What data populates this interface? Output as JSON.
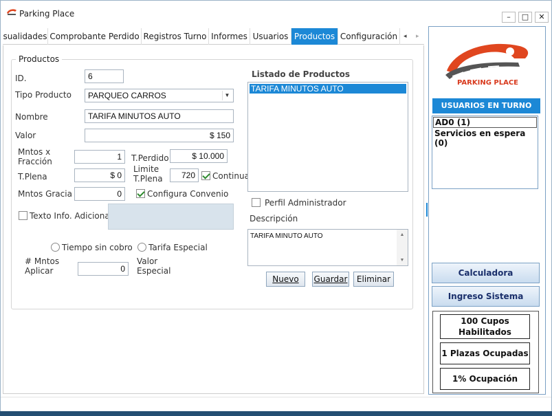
{
  "window": {
    "title": "Parking Place",
    "minimize": "–",
    "maximize": "□",
    "close": "✕"
  },
  "tabs": [
    {
      "label": "sualidades",
      "active": false
    },
    {
      "label": "Comprobante Perdido",
      "active": false
    },
    {
      "label": "Registros Turno",
      "active": false
    },
    {
      "label": "Informes",
      "active": false
    },
    {
      "label": "Usuarios",
      "active": false
    },
    {
      "label": "Productos",
      "active": true
    },
    {
      "label": "Configuración",
      "active": false
    }
  ],
  "tab_scroll": {
    "left": "◂",
    "right": "▸"
  },
  "productos": {
    "group_title": "Productos",
    "id_label": "ID.",
    "id_value": "6",
    "tipo_label": "Tipo Producto",
    "tipo_value": "PARQUEO CARROS",
    "nombre_label": "Nombre",
    "nombre_value": "TARIFA MINUTOS AUTO",
    "valor_label": "Valor",
    "valor_value": "$ 150",
    "mntos_fraccion_label_1": "Mntos x",
    "mntos_fraccion_label_2": "Fracción",
    "mntos_fraccion_value": "1",
    "tperdido_label": "T.Perdido",
    "tperdido_value": "$ 10.000",
    "tplena_label": "T.Plena",
    "tplena_value": "$ 0",
    "limite_label_1": "Limite",
    "limite_label_2": "T.Plena",
    "limite_value": "720",
    "continua_label": "Continua",
    "continua_checked": true,
    "mntos_gracia_label": "Mntos Gracia",
    "mntos_gracia_value": "0",
    "configura_convenio_label": "Configura Convenio",
    "configura_convenio_checked": true,
    "texto_info_label": "Texto Info. Adicional",
    "texto_info_checked": false,
    "tiempo_sin_cobro_label": "Tiempo sin cobro",
    "tarifa_especial_label": "Tarifa Especial",
    "mntos_aplicar_label_1": "# Mntos",
    "mntos_aplicar_label_2": "Aplicar",
    "mntos_aplicar_value": "0",
    "valor_especial_label_1": "Valor",
    "valor_especial_label_2": "Especial",
    "listado_title": "Listado de Productos",
    "listado_items": [
      "TARIFA MINUTOS AUTO"
    ],
    "perfil_admin_label": "Perfil Administrador",
    "perfil_admin_checked": false,
    "descripcion_label": "Descripción",
    "descripcion_value": "TARIFA MINUTO AUTO",
    "buttons": {
      "nuevo": "Nuevo",
      "guardar": "Guardar",
      "eliminar": "Eliminar"
    }
  },
  "sidebar": {
    "logo_text": "PARKING PLACE",
    "usuarios_header": "USUARIOS EN TURNO",
    "usuarios": [
      "AD0 (1)",
      "Servicios en espera (0)"
    ],
    "calculadora": "Calculadora",
    "ingreso_sistema": "Ingreso Sistema",
    "stats": {
      "cupos_line1": "100 Cupos",
      "cupos_line2": "Habilitados",
      "plazas": "1 Plazas Ocupadas",
      "ocupacion": "1% Ocupación"
    }
  },
  "colors": {
    "accent": "#1c88d6",
    "logo_red": "#d83a1e",
    "button_text": "#1a2f6b"
  }
}
